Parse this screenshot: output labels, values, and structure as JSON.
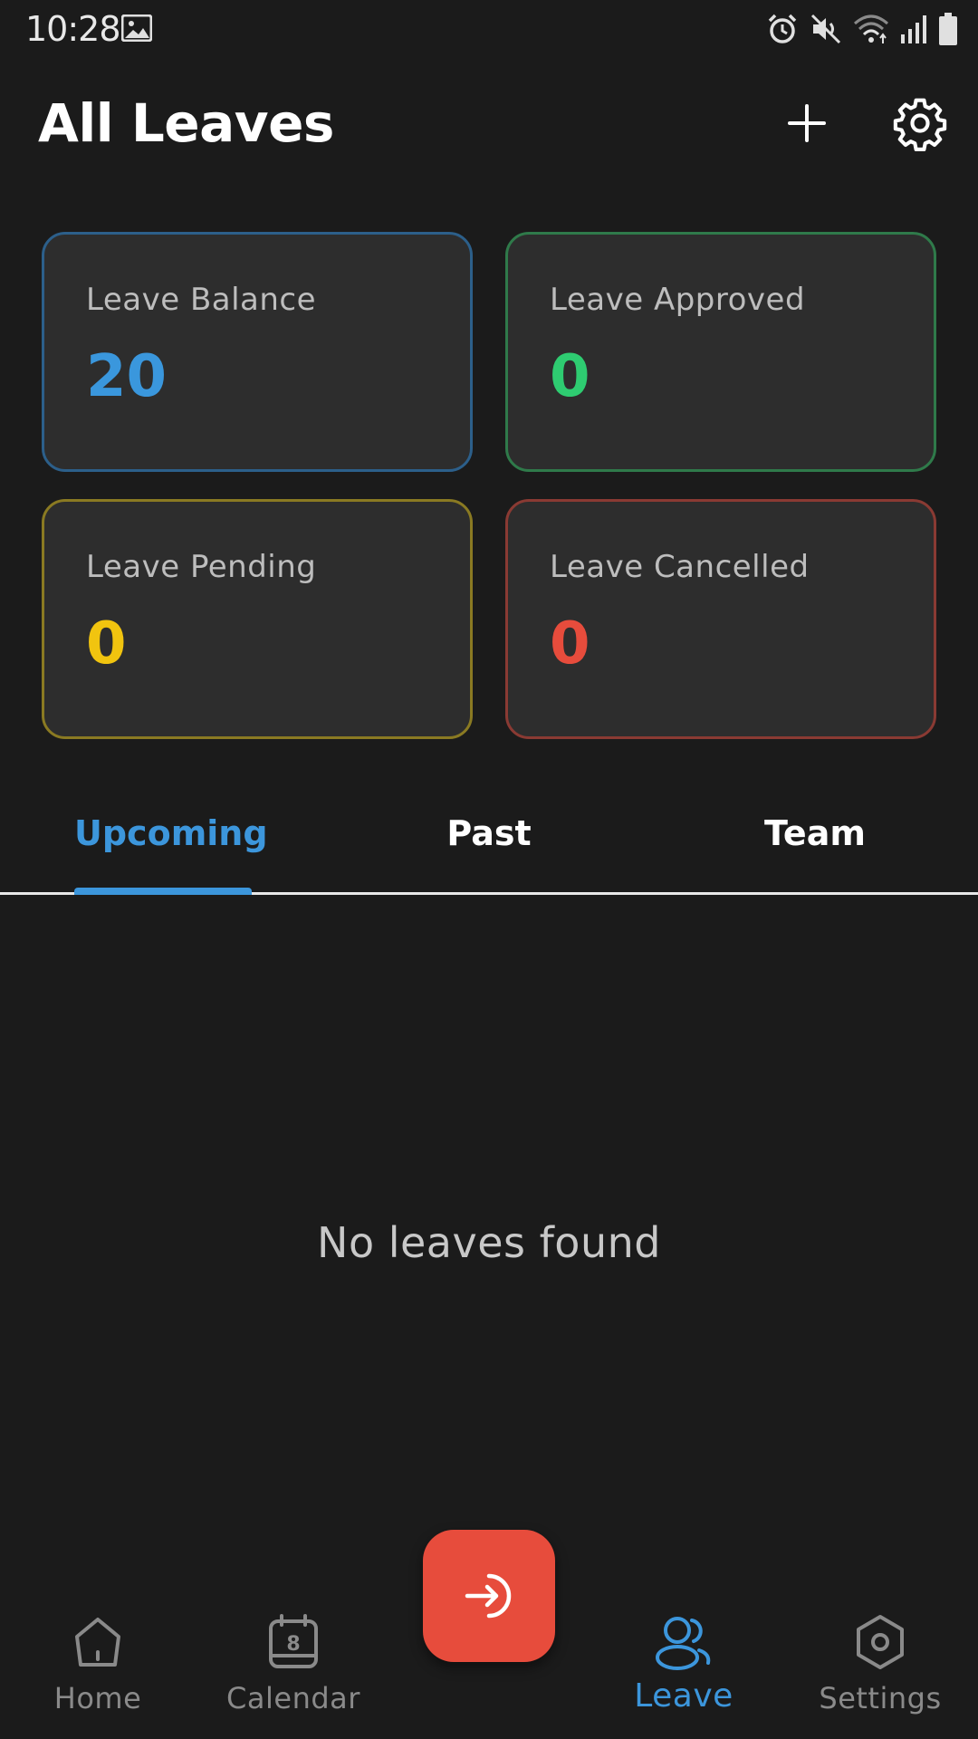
{
  "status_bar": {
    "time": "10:28",
    "icons": [
      "gallery-icon",
      "alarm-icon",
      "mute-icon",
      "wifi-icon",
      "signal-icon",
      "battery-icon"
    ]
  },
  "header": {
    "title": "All Leaves",
    "actions": [
      "plus-icon",
      "gear-icon"
    ]
  },
  "stats": [
    {
      "label": "Leave Balance",
      "value": "20",
      "color": "#3a97dd",
      "border": "#2c5f8a"
    },
    {
      "label": "Leave Approved",
      "value": "0",
      "color": "#2ecc71",
      "border": "#2f7a4a"
    },
    {
      "label": "Leave Pending",
      "value": "0",
      "color": "#f1c40f",
      "border": "#8a7a22"
    },
    {
      "label": "Leave Cancelled",
      "value": "0",
      "color": "#e74c3c",
      "border": "#8a3a33"
    }
  ],
  "tabs": {
    "items": [
      "Upcoming",
      "Past",
      "Team"
    ],
    "active": "Upcoming"
  },
  "empty_state": "No leaves found",
  "bottom_nav": {
    "items": [
      {
        "label": "Home",
        "icon": "home-icon",
        "active": false
      },
      {
        "label": "Calendar",
        "icon": "calendar-icon",
        "active": false,
        "badge": "8"
      },
      {
        "label": "Leave",
        "icon": "users-icon",
        "active": true
      },
      {
        "label": "Settings",
        "icon": "hexagon-settings-icon",
        "active": false
      }
    ],
    "fab_icon": "sign-in-arrow-icon"
  },
  "colors": {
    "background": "#1b1b1b",
    "card_bg": "#2d2d2d",
    "accent": "#3c96dc",
    "fab": "#e74c3c"
  }
}
